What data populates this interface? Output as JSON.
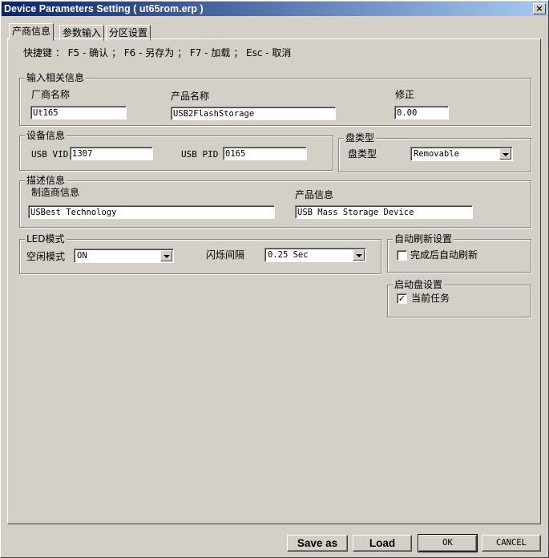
{
  "window": {
    "title": "Device Parameters Setting ( ut65rom.erp )",
    "close_glyph": "×"
  },
  "tabs": [
    {
      "label": "产商信息"
    },
    {
      "label": "参数输入"
    },
    {
      "label": "分区设置"
    }
  ],
  "shortcuts": "快捷键 ： F5 - 确认 ； F6 - 另存为 ； F7 - 加载 ； Esc - 取消",
  "input_group": {
    "legend": "输入相关信息",
    "vendor_label": "厂商名称",
    "vendor_value": "Ut165",
    "product_label": "产品名称",
    "product_value": "USB2FlashStorage",
    "revision_label": "修正",
    "revision_value": "0.00"
  },
  "device_group": {
    "legend": "设备信息",
    "vid_label": "USB VID",
    "vid_value": "1307",
    "pid_label": "USB PID",
    "pid_value": "0165"
  },
  "disk_type_group": {
    "legend": "盘类型",
    "label": "盘类型",
    "value": "Removable"
  },
  "desc_group": {
    "legend": "描述信息",
    "manufacturer_label": "制造商信息",
    "manufacturer_value": "USBest Technology",
    "product_info_label": "产品信息",
    "product_info_value": "USB Mass Storage Device"
  },
  "led_group": {
    "legend": "LED模式",
    "idle_label": "空闲模式",
    "idle_value": "ON",
    "blink_label": "闪烁间隔",
    "blink_value": "0.25 Sec"
  },
  "refresh_group": {
    "legend": "自动刷新设置",
    "checkbox_label": "完成后自动刷新",
    "checked": false
  },
  "boot_group": {
    "legend": "启动盘设置",
    "checkbox_label": "当前任务",
    "checked": true,
    "check_glyph": "✓"
  },
  "buttons": {
    "save_as": "Save as",
    "load": "Load",
    "ok": "OK",
    "cancel": "CANCEL"
  }
}
